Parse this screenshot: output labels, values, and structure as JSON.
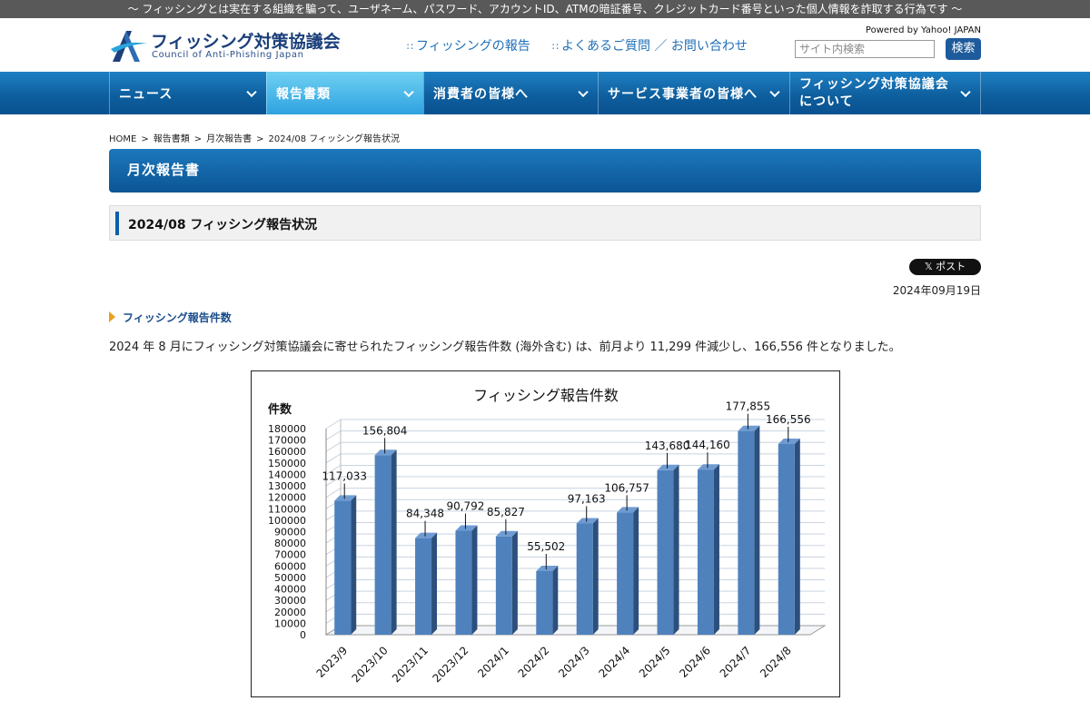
{
  "top_banner": "～ フィッシングとは実在する組織を騙って、ユーザネーム、パスワード、アカウントID、ATMの暗証番号、クレジットカード番号といった個人情報を詐取する行為です ～",
  "logo": {
    "title": "フィッシング対策協議会",
    "subtitle": "Council of Anti-Phishing Japan"
  },
  "header_links": [
    {
      "label": "フィッシングの報告"
    },
    {
      "label": "よくあるご質問 ／ お問い合わせ"
    }
  ],
  "search": {
    "powered": "Powered by Yahoo! JAPAN",
    "placeholder": "サイト内検索",
    "button": "検索"
  },
  "nav": [
    {
      "label": "ニュース"
    },
    {
      "label": "報告書類"
    },
    {
      "label": "消費者の皆様へ"
    },
    {
      "label": "サービス事業者の皆様へ"
    },
    {
      "label": "フィッシング対策協議会",
      "label2": "について"
    }
  ],
  "breadcrumb": [
    "HOME",
    "報告書類",
    "月次報告書",
    "2024/08 フィッシング報告状況"
  ],
  "section_title": "月次報告書",
  "page_title": "2024/08 フィッシング報告状況",
  "post_button": "𝕏 ポスト",
  "date": "2024年09月19日",
  "sub_heading": "フィッシング報告件数",
  "body_text": "2024 年 8 月にフィッシング対策協議会に寄せられたフィッシング報告件数 (海外含む) は、前月より 11,299 件減少し、166,556 件となりました。",
  "colors": {
    "nav": "#0d5d9c",
    "nav_active": "#4fb8ea",
    "bar": "#4f81bd",
    "accent": "#e8a21d"
  },
  "chart_data": {
    "type": "bar",
    "title": "フィッシング報告件数",
    "ylabel": "件数",
    "xlabel": "",
    "ylim": [
      0,
      180000
    ],
    "ytick_step": 10000,
    "grid": true,
    "categories": [
      "2023/9",
      "2023/10",
      "2023/11",
      "2023/12",
      "2024/1",
      "2024/2",
      "2024/3",
      "2024/4",
      "2024/5",
      "2024/6",
      "2024/7",
      "2024/8"
    ],
    "values": [
      117033,
      156804,
      84348,
      90792,
      85827,
      55502,
      97163,
      106757,
      143680,
      144160,
      177855,
      166556
    ],
    "data_labels": [
      "117,033",
      "156,804",
      "84,348",
      "90,792",
      "85,827",
      "55,502",
      "97,163",
      "106,757",
      "143,680",
      "144,160",
      "177,855",
      "166,556"
    ]
  }
}
